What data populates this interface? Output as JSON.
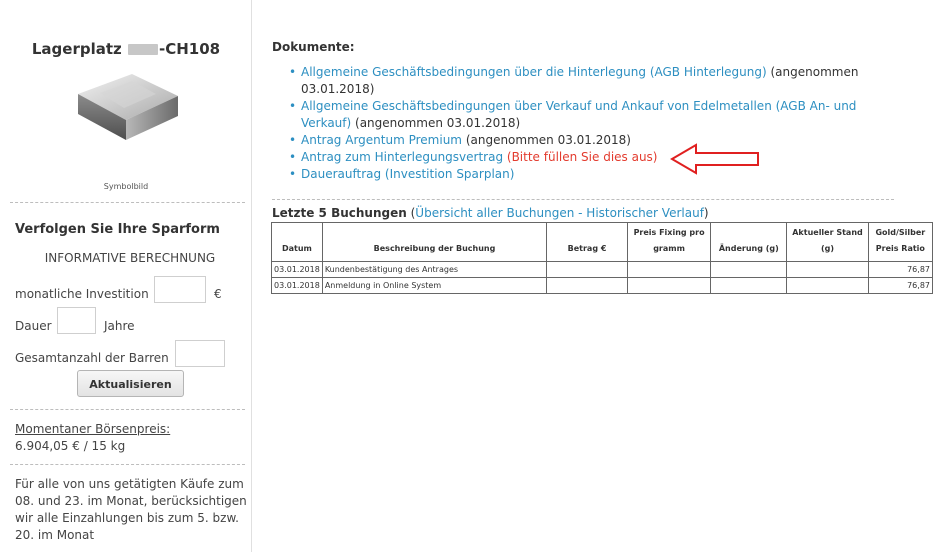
{
  "sidebar": {
    "title_prefix": "Lagerplatz ",
    "title_suffix": "-CH108",
    "image_caption": "Symbolbild",
    "heading": "Verfolgen Sie Ihre Sparform",
    "info_label": "INFORMATIVE BERECHNUNG",
    "monthly_label": "monatliche Investition",
    "currency": "€",
    "duration_label": "Dauer",
    "years_label": "Jahre",
    "bars_label": "Gesamtanzahl der Barren",
    "update_button": "Aktualisieren",
    "market_price_label": "Momentaner Börsenpreis:",
    "market_price_value": "6.904,05 € / 15 kg",
    "note": "Für alle von uns getätigten Käufe zum 08. und 23. im Monat, berücksichtigen wir alle Einzahlungen bis zum 5. bzw. 20. im Monat"
  },
  "documents": {
    "heading": "Dokumente:",
    "items": [
      {
        "link": "Allgemeine Geschäftsbedingungen über die Hinterlegung (AGB Hinterlegung)",
        "status": " (angenommen 03.01.2018)"
      },
      {
        "link": "Allgemeine Geschäftsbedingungen über Verkauf und Ankauf von Edelmetallen (AGB An- und Verkauf)",
        "status": " (angenommen 03.01.2018)"
      },
      {
        "link": "Antrag Argentum Premium",
        "status": " (angenommen 03.01.2018)"
      },
      {
        "link": "Antrag zum Hinterlegungsvertrag",
        "status": " (Bitte füllen Sie dies aus)"
      },
      {
        "link": "Dauerauftrag (Investition Sparplan)",
        "status": ""
      }
    ]
  },
  "bookings": {
    "heading": "Letzte 5 Buchungen",
    "link_open": " (",
    "link": "Übersicht aller Buchungen - Historischer Verlauf",
    "link_close": ")",
    "columns": [
      "Datum",
      "Beschreibung der Buchung",
      "Betrag €",
      "Preis Fixing pro gramm",
      "Änderung (g)",
      "Aktueller Stand (g)",
      "Gold/Silber Preis Ratio"
    ],
    "rows": [
      {
        "datum": "03.01.2018",
        "beschreibung": "Kundenbestätigung des Antrages",
        "ratio": "76,87"
      },
      {
        "datum": "03.01.2018",
        "beschreibung": "Anmeldung in Online System",
        "ratio": "76,87"
      }
    ]
  }
}
